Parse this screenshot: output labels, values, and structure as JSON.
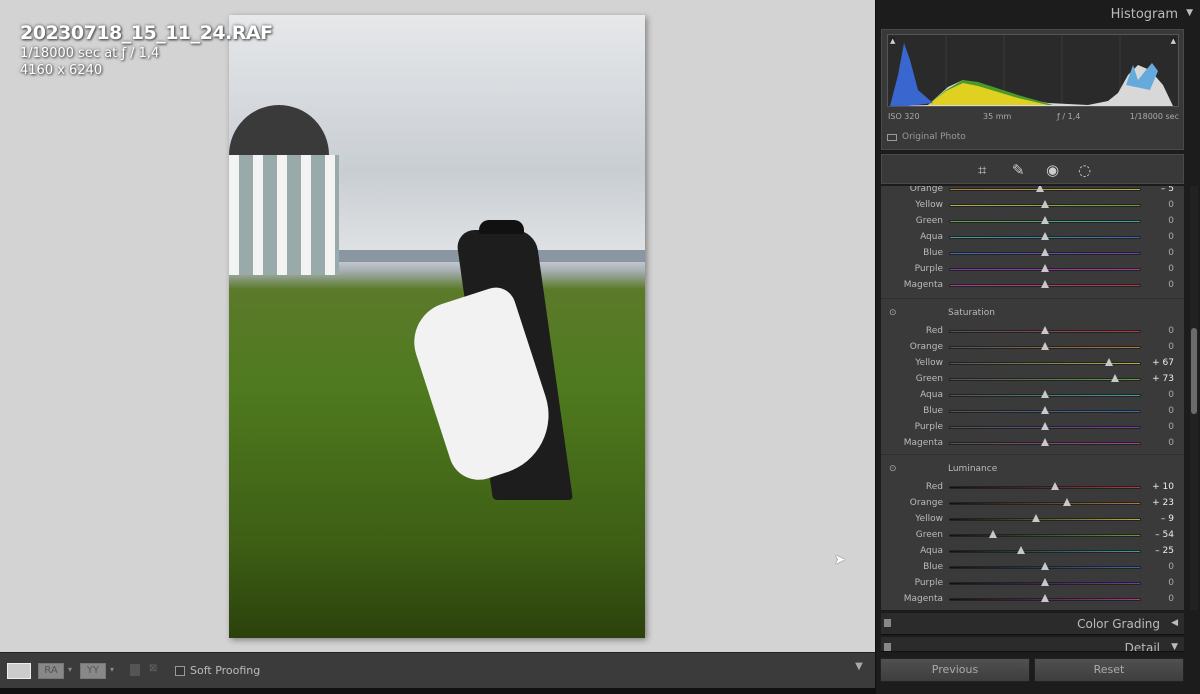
{
  "image_info": {
    "filename": "20230718_15_11_24.RAF",
    "exposure": "1/18000 sec at ƒ / 1,4",
    "dimensions": "4160 x 6240"
  },
  "toolbar": {
    "view_loupe": "loupe-view",
    "compare_ra": "RA",
    "compare_yy": "YY",
    "soft_proofing_label": "Soft Proofing",
    "soft_proofing_checked": false
  },
  "panel": {
    "histogram": {
      "title": "Histogram",
      "iso": "ISO 320",
      "focal": "35 mm",
      "aperture": "ƒ / 1,4",
      "shutter": "1/18000 sec",
      "original_photo": "Original Photo"
    },
    "tools": [
      "crop-icon",
      "healing-icon",
      "red-eye-icon",
      "masking-icon"
    ],
    "hue": [
      {
        "label": "Orange",
        "value": -5,
        "disp": "– 5"
      },
      {
        "label": "Yellow",
        "value": 0,
        "disp": "0"
      },
      {
        "label": "Green",
        "value": 0,
        "disp": "0"
      },
      {
        "label": "Aqua",
        "value": 0,
        "disp": "0"
      },
      {
        "label": "Blue",
        "value": 0,
        "disp": "0"
      },
      {
        "label": "Purple",
        "value": 0,
        "disp": "0"
      },
      {
        "label": "Magenta",
        "value": 0,
        "disp": "0"
      }
    ],
    "saturation_title": "Saturation",
    "saturation": [
      {
        "label": "Red",
        "value": 0,
        "disp": "0"
      },
      {
        "label": "Orange",
        "value": 0,
        "disp": "0"
      },
      {
        "label": "Yellow",
        "value": 67,
        "disp": "+ 67"
      },
      {
        "label": "Green",
        "value": 73,
        "disp": "+ 73"
      },
      {
        "label": "Aqua",
        "value": 0,
        "disp": "0"
      },
      {
        "label": "Blue",
        "value": 0,
        "disp": "0"
      },
      {
        "label": "Purple",
        "value": 0,
        "disp": "0"
      },
      {
        "label": "Magenta",
        "value": 0,
        "disp": "0"
      }
    ],
    "luminance_title": "Luminance",
    "luminance": [
      {
        "label": "Red",
        "value": 10,
        "disp": "+ 10"
      },
      {
        "label": "Orange",
        "value": 23,
        "disp": "+ 23"
      },
      {
        "label": "Yellow",
        "value": -9,
        "disp": "– 9"
      },
      {
        "label": "Green",
        "value": -54,
        "disp": "– 54"
      },
      {
        "label": "Aqua",
        "value": -25,
        "disp": "– 25"
      },
      {
        "label": "Blue",
        "value": 0,
        "disp": "0"
      },
      {
        "label": "Purple",
        "value": 0,
        "disp": "0"
      },
      {
        "label": "Magenta",
        "value": 0,
        "disp": "0"
      }
    ],
    "color_grading": "Color Grading",
    "detail": "Detail",
    "previous": "Previous",
    "reset": "Reset"
  },
  "colors": {
    "Red": "#b23a48",
    "Orange": "#b5793a",
    "Yellow": "#b8b040",
    "Green": "#5fa040",
    "Aqua": "#3fa0a0",
    "Blue": "#3a6cb0",
    "Purple": "#7a3ab0",
    "Magenta": "#b03a9a"
  }
}
